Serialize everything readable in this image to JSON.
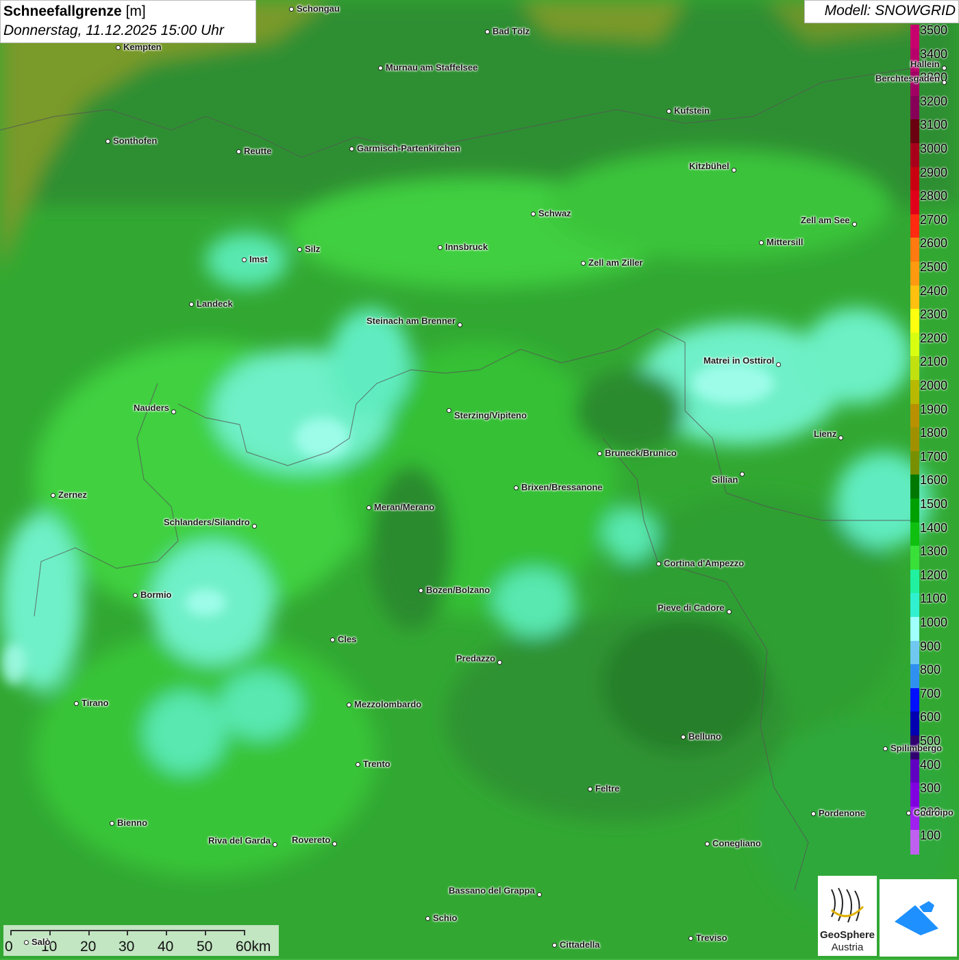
{
  "header": {
    "title": "Schneefallgrenze",
    "unit": "[m]",
    "datetime": "Donnerstag, 11.12.2025 15:00 Uhr",
    "model": "Modell: SNOWGRID"
  },
  "legend": {
    "labels": [
      "3500",
      "3400",
      "3300",
      "3200",
      "3100",
      "3000",
      "2900",
      "2800",
      "2700",
      "2600",
      "2500",
      "2400",
      "2300",
      "2200",
      "2100",
      "2000",
      "1900",
      "1800",
      "1700",
      "1600",
      "1500",
      "1400",
      "1300",
      "1200",
      "1100",
      "1000",
      "900",
      "800",
      "700",
      "600",
      "500",
      "400",
      "300",
      "200",
      "100"
    ],
    "colors": [
      "#c8006e",
      "#b8006a",
      "#a00062",
      "#860058",
      "#6a0010",
      "#a8001a",
      "#c80010",
      "#e0001a",
      "#ff2a10",
      "#ff7a10",
      "#ff9a10",
      "#ffc010",
      "#ffff10",
      "#d8ff10",
      "#c0e010",
      "#b8b800",
      "#b89000",
      "#a09000",
      "#789000",
      "#007800",
      "#00a000",
      "#10c010",
      "#38e038",
      "#20f0a0",
      "#30f0d0",
      "#a0ffff",
      "#70c8f0",
      "#3090f0",
      "#0010ff",
      "#0000b0",
      "#300070",
      "#6000c0",
      "#8000e0",
      "#a020f0",
      "#c060f0"
    ]
  },
  "scalebar": {
    "ticks": [
      "0",
      "10",
      "20",
      "30",
      "40",
      "50",
      "60km"
    ]
  },
  "logos": {
    "geosphere_line1": "GeoSphere",
    "geosphere_line2": "Austria"
  },
  "cities": [
    {
      "name": "Schongau"
    },
    {
      "name": "Kempten"
    },
    {
      "name": "Bad Tölz"
    },
    {
      "name": "Murnau am Staffelsee"
    },
    {
      "name": "Berchtesgaden"
    },
    {
      "name": "Kufstein"
    },
    {
      "name": "Sonthofen"
    },
    {
      "name": "Reutte"
    },
    {
      "name": "Garmisch-Partenkirchen"
    },
    {
      "name": "Kitzbühel"
    },
    {
      "name": "Schwaz"
    },
    {
      "name": "Zell am See"
    },
    {
      "name": "Innsbruck"
    },
    {
      "name": "Mittersill"
    },
    {
      "name": "Imst"
    },
    {
      "name": "Silz"
    },
    {
      "name": "Zell am Ziller"
    },
    {
      "name": "Landeck"
    },
    {
      "name": "Steinach am Brenner"
    },
    {
      "name": "Matrei in Osttirol"
    },
    {
      "name": "Nauders"
    },
    {
      "name": "Sterzing/Vipiteno"
    },
    {
      "name": "Lienz"
    },
    {
      "name": "Bruneck/Brunico"
    },
    {
      "name": "Sillian"
    },
    {
      "name": "Zernez"
    },
    {
      "name": "Brixen/Bressanone"
    },
    {
      "name": "Meran/Merano"
    },
    {
      "name": "Schlanders/Silandro"
    },
    {
      "name": "Cortina d'Ampezzo"
    },
    {
      "name": "Bormio"
    },
    {
      "name": "Bozen/Bolzano"
    },
    {
      "name": "Pieve di Cadore"
    },
    {
      "name": "Cles"
    },
    {
      "name": "Predazzo"
    },
    {
      "name": "Tirano"
    },
    {
      "name": "Mezzolombardo"
    },
    {
      "name": "Belluno"
    },
    {
      "name": "Spilimbergo"
    },
    {
      "name": "Trento"
    },
    {
      "name": "Feltre"
    },
    {
      "name": "Pordenone"
    },
    {
      "name": "Bienno"
    },
    {
      "name": "Riva del Garda"
    },
    {
      "name": "Rovereto"
    },
    {
      "name": "Conegliano"
    },
    {
      "name": "Bassano del Grappa"
    },
    {
      "name": "Schio"
    },
    {
      "name": "Treviso"
    },
    {
      "name": "Cittadella"
    },
    {
      "name": "Hallein"
    },
    {
      "name": "Codroipo"
    },
    {
      "name": "Salò"
    }
  ]
}
